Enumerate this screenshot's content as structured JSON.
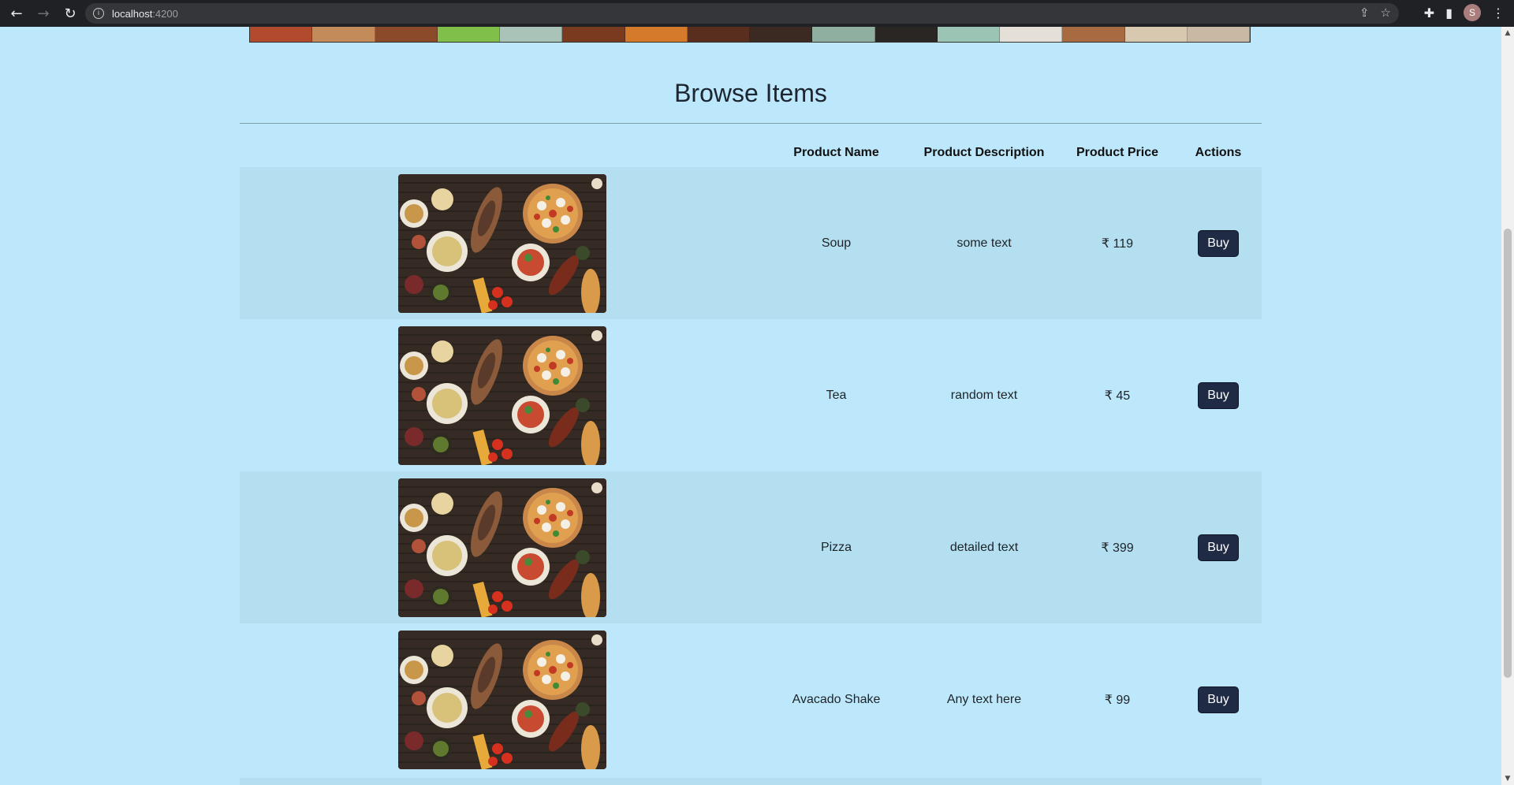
{
  "browser": {
    "back_icon": "arrow-left-icon",
    "forward_icon": "arrow-right-icon",
    "reload_icon": "reload-icon",
    "url_host": "localhost",
    "url_port": ":4200",
    "profile_initial": "S"
  },
  "page": {
    "heading": "Browse Items"
  },
  "table": {
    "columns": [
      "",
      "Product Name",
      "Product Description",
      "Product Price",
      "Actions"
    ],
    "rows": [
      {
        "name": "Soup",
        "description": "some text",
        "price": "₹ 119",
        "action": "Buy"
      },
      {
        "name": "Tea",
        "description": "random text",
        "price": "₹ 45",
        "action": "Buy"
      },
      {
        "name": "Pizza",
        "description": "detailed text",
        "price": "₹ 399",
        "action": "Buy"
      },
      {
        "name": "Avacado Shake",
        "description": "Any text here",
        "price": "₹ 99",
        "action": "Buy"
      }
    ]
  },
  "colors": {
    "page_background": "#bde8fb",
    "striped_row": "#b4dff1",
    "button_background": "#1f2a44"
  }
}
